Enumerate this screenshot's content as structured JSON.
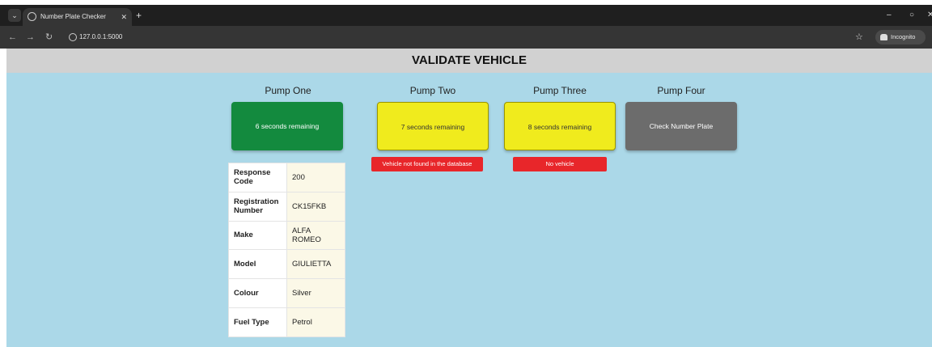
{
  "browser": {
    "tab_title": "Number Plate Checker",
    "url": "127.0.0.1:5000",
    "incognito_label": "Incognito"
  },
  "page": {
    "header": "VALIDATE VEHICLE"
  },
  "pumps": [
    {
      "title": "Pump One",
      "button": "6 seconds remaining",
      "state_color": "#138a3e"
    },
    {
      "title": "Pump Two",
      "button": "7 seconds remaining",
      "state_color": "#f0eb1d",
      "message": "Vehicle not found in the database"
    },
    {
      "title": "Pump Three",
      "button": "8 seconds remaining",
      "state_color": "#f0eb1d",
      "message": "No vehicle"
    },
    {
      "title": "Pump Four",
      "button": "Check Number Plate",
      "state_color": "#6c6c6c"
    }
  ],
  "vehicle_table": [
    {
      "key": "Response Code",
      "value": "200"
    },
    {
      "key": "Registration Number",
      "value": "CK15FKB"
    },
    {
      "key": "Make",
      "value": "ALFA ROMEO"
    },
    {
      "key": "Model",
      "value": "GIULIETTA"
    },
    {
      "key": "Colour",
      "value": "Silver"
    },
    {
      "key": "Fuel Type",
      "value": "Petrol"
    }
  ]
}
